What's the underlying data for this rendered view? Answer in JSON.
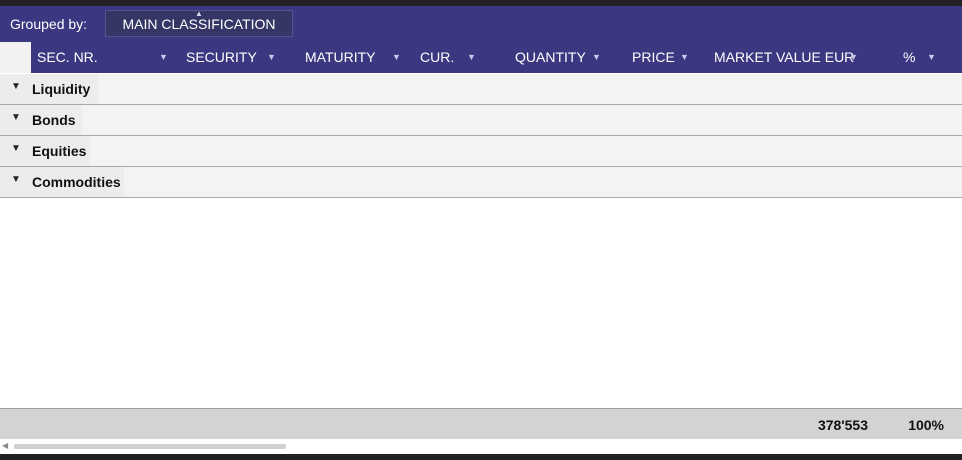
{
  "grouping": {
    "label": "Grouped by:",
    "chip": "MAIN CLASSIFICATION",
    "sort_icon": "sort-up-icon",
    "chip_sorted_ascending": true
  },
  "columns": [
    {
      "key": "sec_nr",
      "label": "SEC. NR."
    },
    {
      "key": "security",
      "label": "SECURITY"
    },
    {
      "key": "maturity",
      "label": "MATURITY"
    },
    {
      "key": "currency",
      "label": "CUR."
    },
    {
      "key": "quantity",
      "label": "QUANTITY"
    },
    {
      "key": "price",
      "label": "PRICE"
    },
    {
      "key": "market_value",
      "label": "MARKET VALUE EUR"
    },
    {
      "key": "percent",
      "label": "%"
    }
  ],
  "column_menu_icon": "chevron-down-icon",
  "groups": [
    {
      "label": "Liquidity",
      "expanded": false
    },
    {
      "label": "Bonds",
      "expanded": false
    },
    {
      "label": "Equities",
      "expanded": false
    },
    {
      "label": "Commodities",
      "expanded": false
    }
  ],
  "totals": {
    "market_value": "378'553",
    "percent": "100%"
  },
  "colors": {
    "header_bg": "#3b3780",
    "chip_bg": "#353566",
    "row_bg": "#f3f3f3",
    "footer_bg": "#d3d3d3"
  }
}
